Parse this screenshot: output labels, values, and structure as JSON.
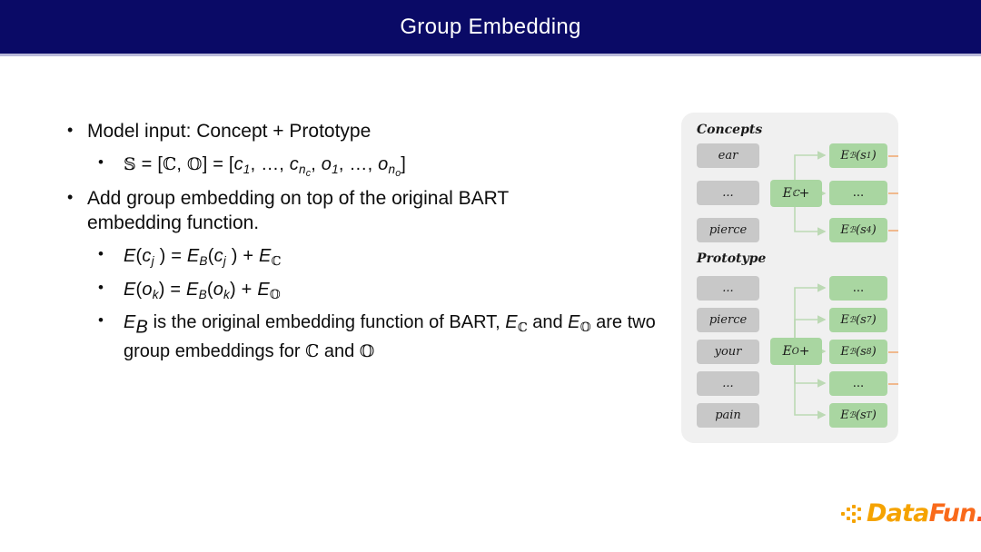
{
  "header": {
    "title": "Group Embedding",
    "bg_color": "#0a0a66",
    "text_color": "#ffffff",
    "underline_color": "#b9b9d9"
  },
  "content": {
    "bullet1": {
      "marker": "•",
      "text": "Model input: Concept + Prototype"
    },
    "bullet1_sub": {
      "marker": "•",
      "s": "𝕊",
      "eq1": " = [",
      "c": "ℂ",
      "comma": ", ",
      "o": "𝕆",
      "close1": "] = [",
      "c1": "c",
      "sub1": "1",
      "ellipsis1": ", …, ",
      "c2": "c",
      "subn": "n",
      "subnc": "c",
      "ellipsis2": ", ",
      "o1": "o",
      "sub1b": "1",
      "ellipsis3": ", …, ",
      "o2": "o",
      "subno": "n",
      "subnoo": "o",
      "close2": "]"
    },
    "bullet2": {
      "marker": "•",
      "text": "Add group embedding on top of the original BART embedding function."
    },
    "bullet2_sub1": {
      "marker": "•",
      "E": "E",
      "open": "(",
      "c": "c",
      "subj": "j",
      "close": " ) = ",
      "E2": "E",
      "subB": "B",
      "open2": "(",
      "c2": "c",
      "subj2": "j",
      "close2": " ) + ",
      "E3": "E",
      "subC": "ℂ"
    },
    "bullet2_sub2": {
      "marker": "•",
      "E": "E",
      "open": "(",
      "o": "o",
      "subk": "k",
      "close": ") = ",
      "E2": "E",
      "subB": "B",
      "open2": "(",
      "o2": "o",
      "subk2": "k",
      "close2": ") + ",
      "E3": "E",
      "subO": "𝕆"
    },
    "bullet2_sub3": {
      "marker": "•",
      "E": "E",
      "subB": "B",
      "text1": " is the original embedding function of BART, ",
      "E2": "E",
      "subC": "ℂ",
      "text2": " and ",
      "E3": "E",
      "subO": "𝕆",
      "text3": " are two group embeddings for ",
      "C": "ℂ",
      "text4": " and ",
      "O": "𝕆"
    }
  },
  "diagram": {
    "panel_bg": "#f0f0f0",
    "gray_box_color": "#c8c8c8",
    "green_box_color": "#a9d6a1",
    "arrow_color": "#bcd9b4",
    "orange_line_color": "#f0b98e",
    "concepts": {
      "label": "Concepts",
      "tokens": [
        "ear",
        "...",
        "pierce"
      ],
      "group_box": "E_C +",
      "group_box_E": "E",
      "group_box_sub": "ℂ",
      "group_box_plus": " +",
      "outputs": [
        {
          "E": "E",
          "sub": "ℬ",
          "open": "(s",
          "idx": "1",
          "close": ")"
        },
        {
          "E": "",
          "sub": "",
          "open": "",
          "idx": "",
          "close": "...",
          "is_ellipsis": true
        },
        {
          "E": "E",
          "sub": "ℬ",
          "open": "(s",
          "idx": "4",
          "close": ")"
        }
      ]
    },
    "prototype": {
      "label": "Prototype",
      "tokens": [
        "...",
        "pierce",
        "your",
        "...",
        "pain"
      ],
      "group_box_E": "E",
      "group_box_sub": "O",
      "group_box_plus": " +",
      "outputs": [
        {
          "E": "",
          "sub": "",
          "open": "",
          "idx": "",
          "close": "...",
          "is_ellipsis": true
        },
        {
          "E": "E",
          "sub": "ℬ",
          "open": "(s",
          "idx": "7",
          "close": ")"
        },
        {
          "E": "E",
          "sub": "ℬ",
          "open": "(s",
          "idx": "8",
          "close": ")"
        },
        {
          "E": "",
          "sub": "",
          "open": "",
          "idx": "",
          "close": "...",
          "is_ellipsis": true
        },
        {
          "E": "E",
          "sub": "ℬ",
          "open": "(s",
          "idx": "T",
          "close": ")"
        }
      ]
    }
  },
  "logo": {
    "part1": "Data",
    "part2": "Fun",
    "part3": ".",
    "color1": "#f5a300",
    "color2": "#f96a1b"
  }
}
